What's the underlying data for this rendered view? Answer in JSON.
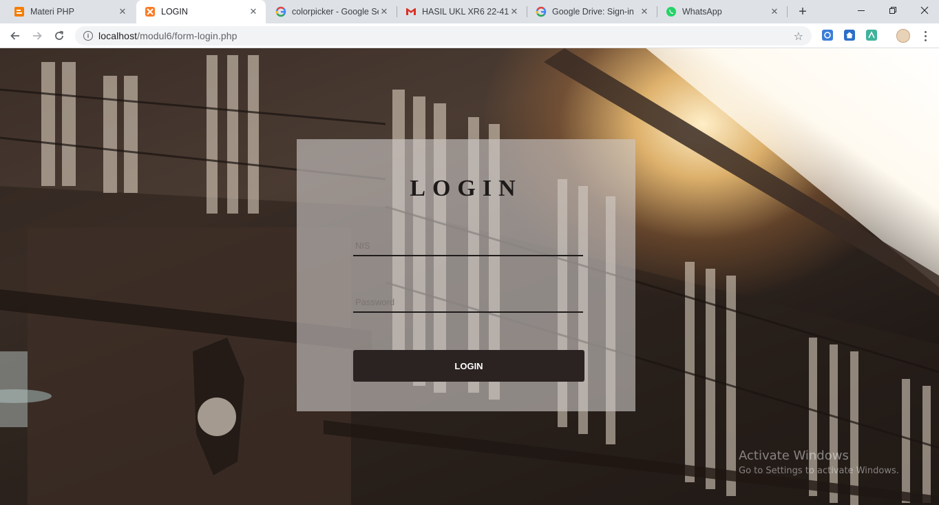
{
  "browser": {
    "tabs": [
      {
        "title": "Materi PHP",
        "icon": "blogger-icon",
        "active": false
      },
      {
        "title": "LOGIN",
        "icon": "xampp-icon",
        "active": true
      },
      {
        "title": "colorpicker - Google Se",
        "icon": "google-icon",
        "active": false
      },
      {
        "title": "HASIL UKL XR6 22-41 -",
        "icon": "gmail-icon",
        "active": false
      },
      {
        "title": "Google Drive: Sign-in",
        "icon": "google-icon",
        "active": false
      },
      {
        "title": "WhatsApp",
        "icon": "whatsapp-icon",
        "active": false
      }
    ],
    "address": {
      "host": "localhost",
      "path": "/modul6/form-login.php"
    }
  },
  "login": {
    "title": "LOGIN",
    "nis_placeholder": "NIS",
    "password_placeholder": "Password",
    "button_label": "LOGIN"
  },
  "watermark": {
    "line1": "Activate Windows",
    "line2": "Go to Settings to activate Windows."
  },
  "colors": {
    "tabbar": "#dee1e6",
    "button": "#2b2222",
    "panel": "#cdc8c6"
  }
}
